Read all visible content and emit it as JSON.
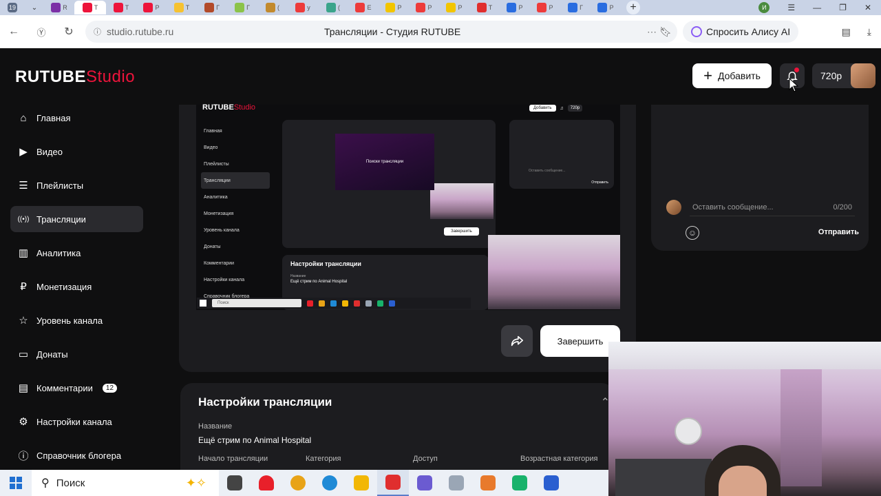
{
  "browser": {
    "tab_counter": "19",
    "active_tab_letter": "Т",
    "tabs": [
      {
        "color": "#7b2fa6",
        "label": "R"
      },
      {
        "color": "#ed143b",
        "label": "Т"
      },
      {
        "color": "#ed143b",
        "label": "Т"
      },
      {
        "color": "#ed143b",
        "label": "Р"
      },
      {
        "color": "#f6c231",
        "label": "Т"
      },
      {
        "color": "#b24a2a",
        "label": "Г"
      },
      {
        "color": "#8bc34a",
        "label": "Г"
      },
      {
        "color": "#c28a2e",
        "label": "("
      },
      {
        "color": "#ed3b3b",
        "label": "у"
      },
      {
        "color": "#3aa48b",
        "label": "("
      },
      {
        "color": "#ed3b3b",
        "label": "Е"
      },
      {
        "color": "#f2c500",
        "label": "Р"
      },
      {
        "color": "#ed3b3b",
        "label": "Р"
      },
      {
        "color": "#f2c500",
        "label": "Р"
      },
      {
        "color": "#e02e2e",
        "label": "Т"
      },
      {
        "color": "#2a6de0",
        "label": "Р"
      },
      {
        "color": "#ed3b3b",
        "label": "Р"
      },
      {
        "color": "#2a6de0",
        "label": "Г"
      },
      {
        "color": "#2a6de0",
        "label": "Р"
      }
    ],
    "profile_letter": "И",
    "url": "studio.rutube.ru",
    "page_title": "Трансляции - Студия RUTUBE",
    "alice_label": "Спросить Алису AI"
  },
  "header": {
    "logo_main": "RUTUBE",
    "logo_studio": "Studio",
    "add_label": "Добавить",
    "quality": "720p"
  },
  "sidebar": {
    "items": [
      {
        "label": "Главная"
      },
      {
        "label": "Видео"
      },
      {
        "label": "Плейлисты"
      },
      {
        "label": "Трансляции"
      },
      {
        "label": "Аналитика"
      },
      {
        "label": "Монетизация"
      },
      {
        "label": "Уровень канала"
      },
      {
        "label": "Донаты"
      },
      {
        "label": "Комментарии",
        "badge": "12"
      },
      {
        "label": "Настройки канала"
      },
      {
        "label": "Справочник блогера"
      }
    ]
  },
  "preview": {
    "logo_main": "RUTUBE",
    "logo_studio": "Studio",
    "add_label": "Добавить",
    "quality": "720p",
    "video_caption": "Поиски трансляции",
    "side_items": [
      "Главная",
      "Видео",
      "Плейлисты",
      "Трансляции",
      "Аналитика",
      "Монетизация",
      "Уровень канала",
      "Донаты",
      "Комментарии",
      "Настройки канала",
      "Справочник блогера"
    ],
    "finish_label": "Завершить",
    "settings_title": "Настройки трансляции",
    "name_label": "Название",
    "name_value": "Ещё стрим по Animal Hospital",
    "cols": [
      "Начало трансляции",
      "Категория",
      "Доступ",
      "Возрастная категория"
    ],
    "chat_placeholder": "Оставить сообщение...",
    "chat_send": "Отправить",
    "search_label": "Поиск"
  },
  "controls": {
    "finish_label": "Завершить"
  },
  "settings": {
    "title": "Настройки трансляции",
    "name_label": "Название",
    "name_value": "Ещё стрим по Animal Hospital",
    "start_label": "Начало трансляции",
    "category_label": "Категория",
    "access_label": "Доступ",
    "age_label": "Возрастная категория"
  },
  "chat": {
    "placeholder": "Оставить сообщение...",
    "counter": "0/200",
    "send_label": "Отправить"
  },
  "taskbar": {
    "search_label": "Поиск",
    "apps": [
      {
        "name": "task-view",
        "color": "#444"
      },
      {
        "name": "heart",
        "color": "#e8202a"
      },
      {
        "name": "chrome",
        "color": "#e8a317"
      },
      {
        "name": "edge",
        "color": "#1f8ad6"
      },
      {
        "name": "explorer",
        "color": "#f2b705"
      },
      {
        "name": "yandex",
        "color": "#e02e2e"
      },
      {
        "name": "app-a",
        "color": "#6b5bd1"
      },
      {
        "name": "app-b",
        "color": "#9aa6b5"
      },
      {
        "name": "app-c",
        "color": "#e87a2c"
      },
      {
        "name": "app-d",
        "color": "#18b26b"
      },
      {
        "name": "app-e",
        "color": "#2a5fd0"
      }
    ]
  }
}
